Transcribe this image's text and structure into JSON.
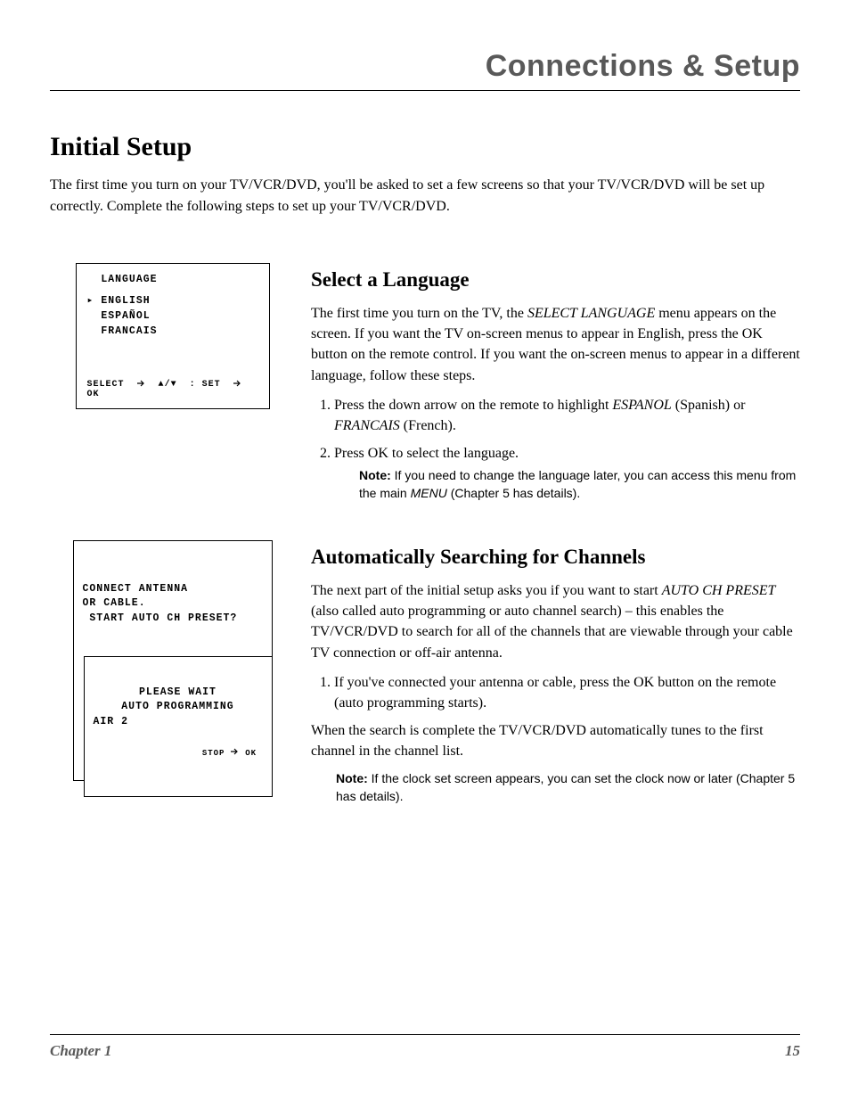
{
  "header": {
    "section_title": "Connections & Setup"
  },
  "h1": "Initial Setup",
  "intro": "The first time you turn on your TV/VCR/DVD, you'll be asked to set a few screens so that your TV/VCR/DVD will be set up correctly. Complete the following steps to set up your TV/VCR/DVD.",
  "sections": {
    "language": {
      "osd": {
        "title": "LANGUAGE",
        "items": [
          "ENGLISH",
          "ESPAÑOL",
          "FRANCAIS"
        ],
        "footer_select": "SELECT",
        "footer_set": ": SET",
        "footer_ok": "OK"
      },
      "heading": "Select a Language",
      "para_pre": "The first time you turn on the TV, the ",
      "para_ital": "SELECT LANGUAGE",
      "para_post": " menu appears on the screen. If you want the TV on-screen menus to appear in English, press the OK button on the remote control. If you want the on-screen menus to appear in a different language, follow these steps.",
      "steps": [
        {
          "pre": "Press the down arrow on the remote to highlight ",
          "ital1": "ESPANOL",
          "mid": " (Spanish) or ",
          "ital2": "FRANCAIS",
          "post": " (French)."
        },
        {
          "pre": "Press OK to select the language.",
          "ital1": "",
          "mid": "",
          "ital2": "",
          "post": ""
        }
      ],
      "note_label": "Note:",
      "note_pre": " If you need to change the language later, you can access this menu from the main ",
      "note_ital": "MENU",
      "note_post": " (Chapter 5 has details)."
    },
    "channels": {
      "osd_outer": {
        "line1": "CONNECT ANTENNA",
        "line2": "OR CABLE.",
        "line3": "START AUTO CH PRESET?"
      },
      "osd_inner": {
        "line1": "PLEASE WAIT",
        "line2": "AUTO PROGRAMMING",
        "line3": "AIR 2",
        "footer_stop": "STOP",
        "footer_ok": "OK"
      },
      "heading": "Automatically Searching for Channels",
      "para1_pre": "The next part of the initial setup asks you if you want to start ",
      "para1_ital": "AUTO CH PRESET",
      "para1_post": " (also called auto programming or auto channel search) – this enables the TV/VCR/DVD to search for all of the channels that are viewable through your cable TV connection or off-air antenna.",
      "step1": "If you've connected your antenna or cable, press the OK button on the remote (auto programming starts).",
      "para2": "When the search is complete the TV/VCR/DVD automatically tunes to the first channel in the channel list.",
      "note_label": "Note:",
      "note_text": " If the clock set screen appears, you can set the clock now or later (Chapter 5 has details)."
    }
  },
  "footer": {
    "chapter": "Chapter 1",
    "page": "15"
  }
}
